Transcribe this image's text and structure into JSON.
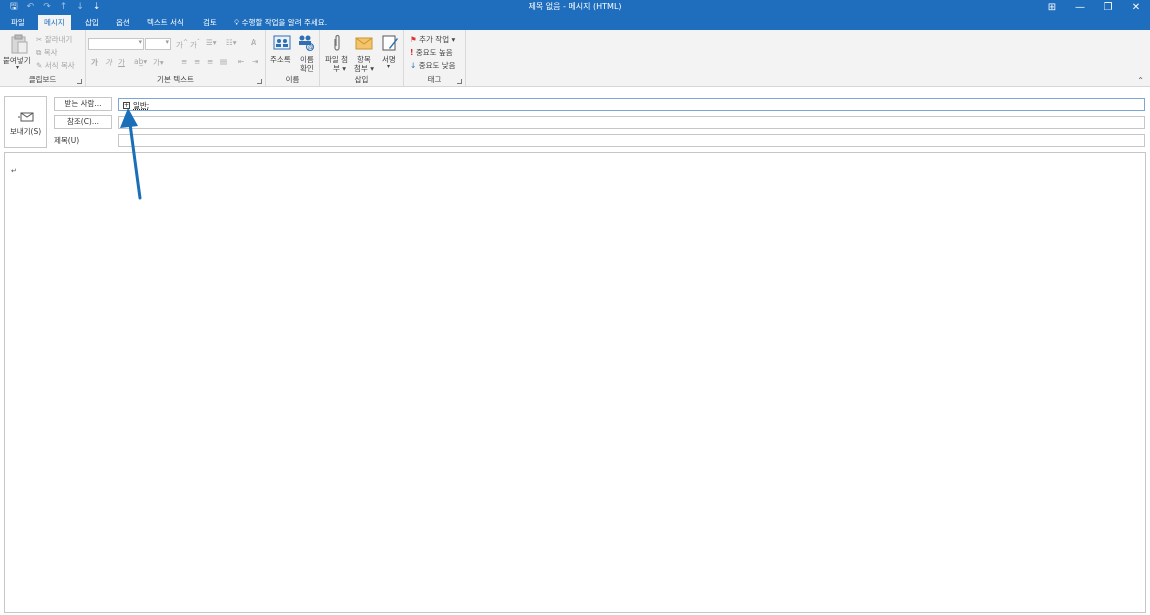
{
  "window": {
    "title": "제목 없음 - 메시지 (HTML)",
    "controls": [
      "⊞",
      "—",
      "❐",
      "✕"
    ]
  },
  "qat": [
    "save-icon",
    "undo-icon",
    "redo-icon",
    "up-icon",
    "down-icon",
    "customize-icon"
  ],
  "tabs": [
    {
      "label": "파일"
    },
    {
      "label": "메시지"
    },
    {
      "label": "삽입"
    },
    {
      "label": "옵션"
    },
    {
      "label": "텍스트 서식"
    },
    {
      "label": "검토"
    }
  ],
  "tell_me": "수행할 작업을 알려 주세요.",
  "ribbon": {
    "clipboard": {
      "paste": "붙여넣기",
      "cut": "잘라내기",
      "copy": "복사",
      "format_painter": "서식 복사",
      "label": "클립보드"
    },
    "basic_text": {
      "bold": "가",
      "italic": "가",
      "underline": "가",
      "grow": "가",
      "shrink": "가",
      "highlight": "가",
      "font_color": "가",
      "label": "기본 텍스트"
    },
    "names": {
      "address_book": "주소록",
      "check_names_1": "이름",
      "check_names_2": "확인",
      "label": "이름"
    },
    "insert": {
      "attach_1": "파일 첨",
      "attach_2": "부",
      "item_1": "항목",
      "item_2": "첨부",
      "signature": "서명",
      "label": "삽입"
    },
    "tags": {
      "follow_up": "추가 작업",
      "high": "중요도 높음",
      "low": "중요도 낮음",
      "label": "태그"
    }
  },
  "compose": {
    "send": "보내기(S)",
    "to_button": "받는 사람...",
    "cc_button": "참조(C)...",
    "subject_label": "제목(U)",
    "to_value": "일반;",
    "cc_value": "",
    "subject_value": ""
  },
  "body": {
    "paragraph_mark": "↵"
  },
  "colors": {
    "titlebar": "#1f6ebe",
    "ribbon": "#f3f3f3",
    "arrow": "#1a6fb8"
  }
}
